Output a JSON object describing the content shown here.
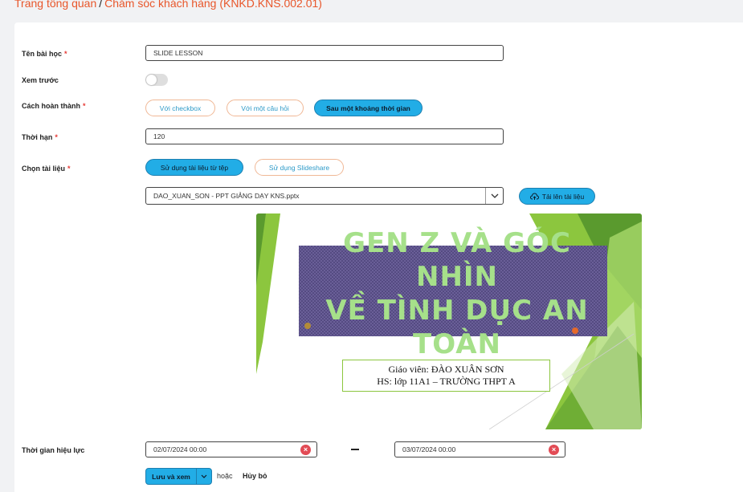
{
  "breadcrumb": {
    "home": "Trang tổng quan",
    "separator": "/",
    "current": "Chăm sóc khách hàng (KNKD.KNS.002.01)"
  },
  "form": {
    "lesson_name": {
      "label": "Tên bài học",
      "required": "*",
      "value": "SLIDE LESSON"
    },
    "preview": {
      "label": "Xem trước",
      "enabled": false
    },
    "completion": {
      "label": "Cách hoàn thành",
      "required": "*",
      "options": [
        "Với checkbox",
        "Với một câu hỏi",
        "Sau một khoảng thời gian"
      ],
      "selected": "Sau một khoảng thời gian"
    },
    "duration": {
      "label": "Thời hạn",
      "required": "*",
      "value": "120"
    },
    "material": {
      "label": "Chọn tài liệu",
      "required": "*",
      "options": [
        "Sử dụng tài liệu từ tệp",
        "Sử dụng Slideshare"
      ],
      "selected": "Sử dụng tài liệu từ tệp",
      "file": "DAO_XUAN_SON - PPT GIẢNG DẠY KNS.pptx",
      "upload_label": "Tải lên tài liệu"
    },
    "slide_preview": {
      "title_lines": [
        "GEN Z VÀ GÓC",
        "NHÌN",
        "VỀ TÌNH DỤC AN",
        "TOÀN"
      ],
      "teacher": "Giáo viên: ĐÀO XUÂN SƠN",
      "class_info": "HS: lớp 11A1 – TRƯỜNG THPT A"
    },
    "validity": {
      "label": "Thời gian hiệu lực",
      "start": "02/07/2024 00:00",
      "end": "03/07/2024 00:00"
    },
    "actions": {
      "save_label": "Lưu và xem",
      "or_label": "hoặc",
      "cancel_label": "Hủy bỏ"
    }
  },
  "colors": {
    "breadcrumb": "#e8562a",
    "accent": "#22ade6",
    "required": "#e53935",
    "slide_green": "#8cc63e",
    "slide_title": "#a6e08a"
  }
}
